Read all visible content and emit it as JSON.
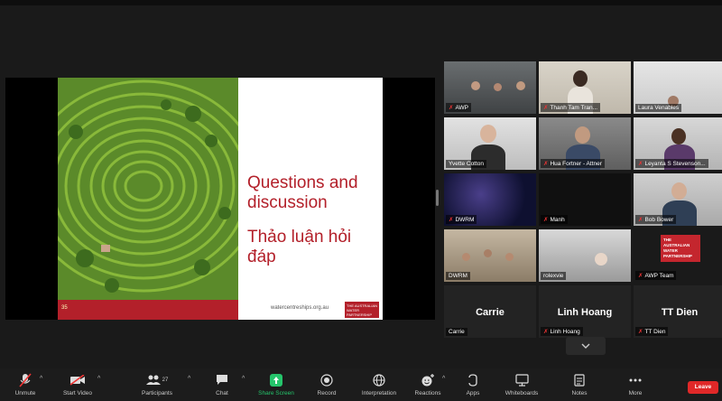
{
  "slide": {
    "title_line1": "Questions and",
    "title_line2": "discussion",
    "vi_line1": "Thảo luận hỏi",
    "vi_line2": "đáp",
    "url": "watercentreships.org.au",
    "logo_text": "THE AUSTRALIAN WATER PARTNERSHIP",
    "page": "35"
  },
  "participants": [
    {
      "name": "AWP",
      "muted": true
    },
    {
      "name": "Thanh Tam Tran...",
      "muted": true
    },
    {
      "name": "Laura Venables",
      "muted": false
    },
    {
      "name": "Yvette Cotton",
      "muted": false
    },
    {
      "name": "Hua Fortner - Attner",
      "muted": true
    },
    {
      "name": "Leyanta S Stevenson...",
      "muted": true
    },
    {
      "name": "DWRM",
      "muted": true
    },
    {
      "name": "Manh",
      "muted": true
    },
    {
      "name": "Bob Bower",
      "muted": true
    },
    {
      "name": "DWRM",
      "muted": false
    },
    {
      "name": "rolexvie",
      "muted": false
    },
    {
      "name": "AWP Team",
      "muted": true
    },
    {
      "name": "Carrie",
      "muted": false,
      "display": "Carrie"
    },
    {
      "name": "Linh Hoang",
      "muted": true,
      "display": "Linh Hoang"
    },
    {
      "name": "TT Dien",
      "muted": true,
      "display": "TT Dien"
    }
  ],
  "awp_tile_logo": "THE AUSTRALIAN WATER PARTNERSHIP",
  "toolbar": {
    "unmute": "Unmute",
    "start_video": "Start Video",
    "participants": "Participants",
    "participants_count": "27",
    "chat": "Chat",
    "share_screen": "Share Screen",
    "record": "Record",
    "interpretation": "Interpretation",
    "reactions": "Reactions",
    "apps": "Apps",
    "whiteboards": "Whiteboards",
    "notes": "Notes",
    "more": "More",
    "leave": "Leave"
  },
  "colors": {
    "accent_red": "#b3202a",
    "share_green": "#25c46b",
    "leave_red": "#e02828",
    "active_speaker": "#c6d84a"
  }
}
